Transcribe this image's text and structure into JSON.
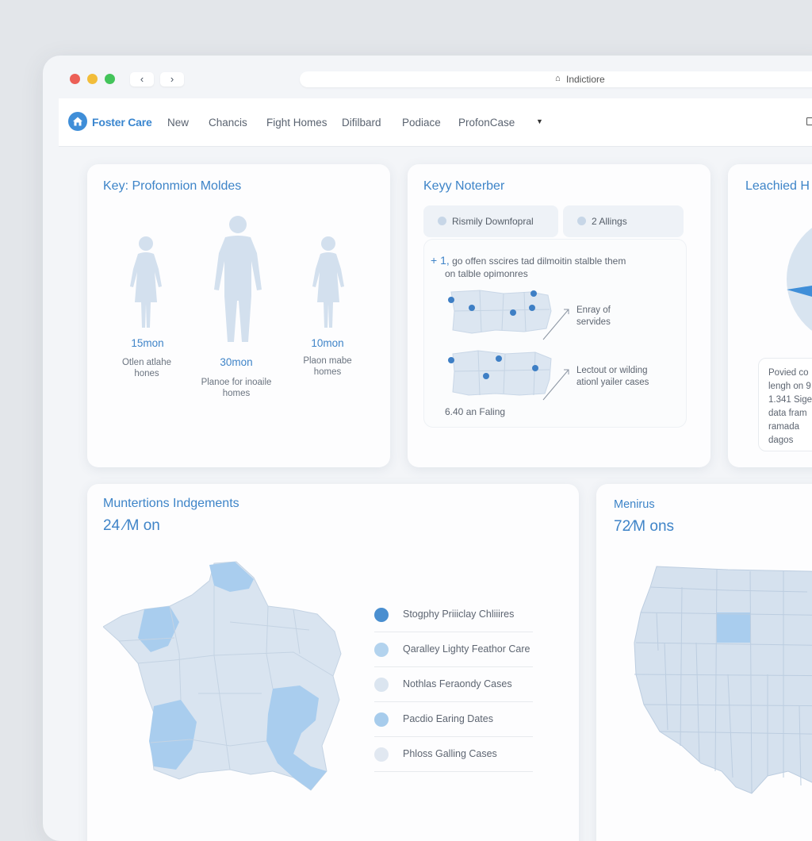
{
  "browser": {
    "url": "Indictiore",
    "back_icon": "chevron-left-icon",
    "forward_icon": "chevron-right-icon",
    "traffic_lights": [
      "#ec5f56",
      "#f2bd3a",
      "#43c45a"
    ]
  },
  "appnav": {
    "brand": "Foster Care",
    "items": [
      "New",
      "Chancis",
      "Fight Homes",
      "Difilbard",
      "Podiace",
      "ProfonCase"
    ],
    "accent": "#3f8ed8"
  },
  "card_profiles": {
    "title": "Key: Profonmion Moldes",
    "figures": [
      {
        "value": "15mon",
        "label_line1": "Otlen atlahe",
        "label_line2": "hones"
      },
      {
        "value": "30mon",
        "label_line1": "Planoe for inoaile",
        "label_line2": "homes"
      },
      {
        "value": "10mon",
        "label_line1": "Plaon mabe",
        "label_line2": "homes"
      }
    ]
  },
  "card_notes": {
    "title": "Keyy Noterber",
    "pill1": "Rismily Downfopral",
    "pill2": "2 Allings",
    "note_line1": "go offen sscires tad dilmoitin stalble them",
    "note_line2": "on talble opimonres",
    "note_prefix": "+ 1,",
    "annotation1_line1": "Enray of",
    "annotation1_line2": "servides",
    "annotation2_line1": "Lectout or wilding",
    "annotation2_line2": "ationl yailer cases",
    "footer": "6.40 an Faling"
  },
  "card_reach": {
    "title": "Leachied H",
    "text_lines": [
      "Povied co",
      "lengh on 9",
      "1.341 Sige",
      "data fram",
      "ramada",
      "dagos"
    ]
  },
  "card_judgements": {
    "title": "Muntertions Indgements",
    "big_stat": "24 ⁄M on",
    "legend": [
      {
        "label": "Stogphy Priiiclay Chliiires",
        "color": "#4a8fd0"
      },
      {
        "label": "Qaralley Lighty Feathor Care",
        "color": "#b3d3ee"
      },
      {
        "label": "Nothlas Feraondy Cases",
        "color": "#dbe5f0"
      },
      {
        "label": "Pacdio Earing Dates",
        "color": "#a7ccec"
      },
      {
        "label": "Phloss Galling Cases",
        "color": "#e1e8f1"
      }
    ]
  },
  "card_menus": {
    "title": "Menirus",
    "big_stat": "72⁄M ons"
  }
}
